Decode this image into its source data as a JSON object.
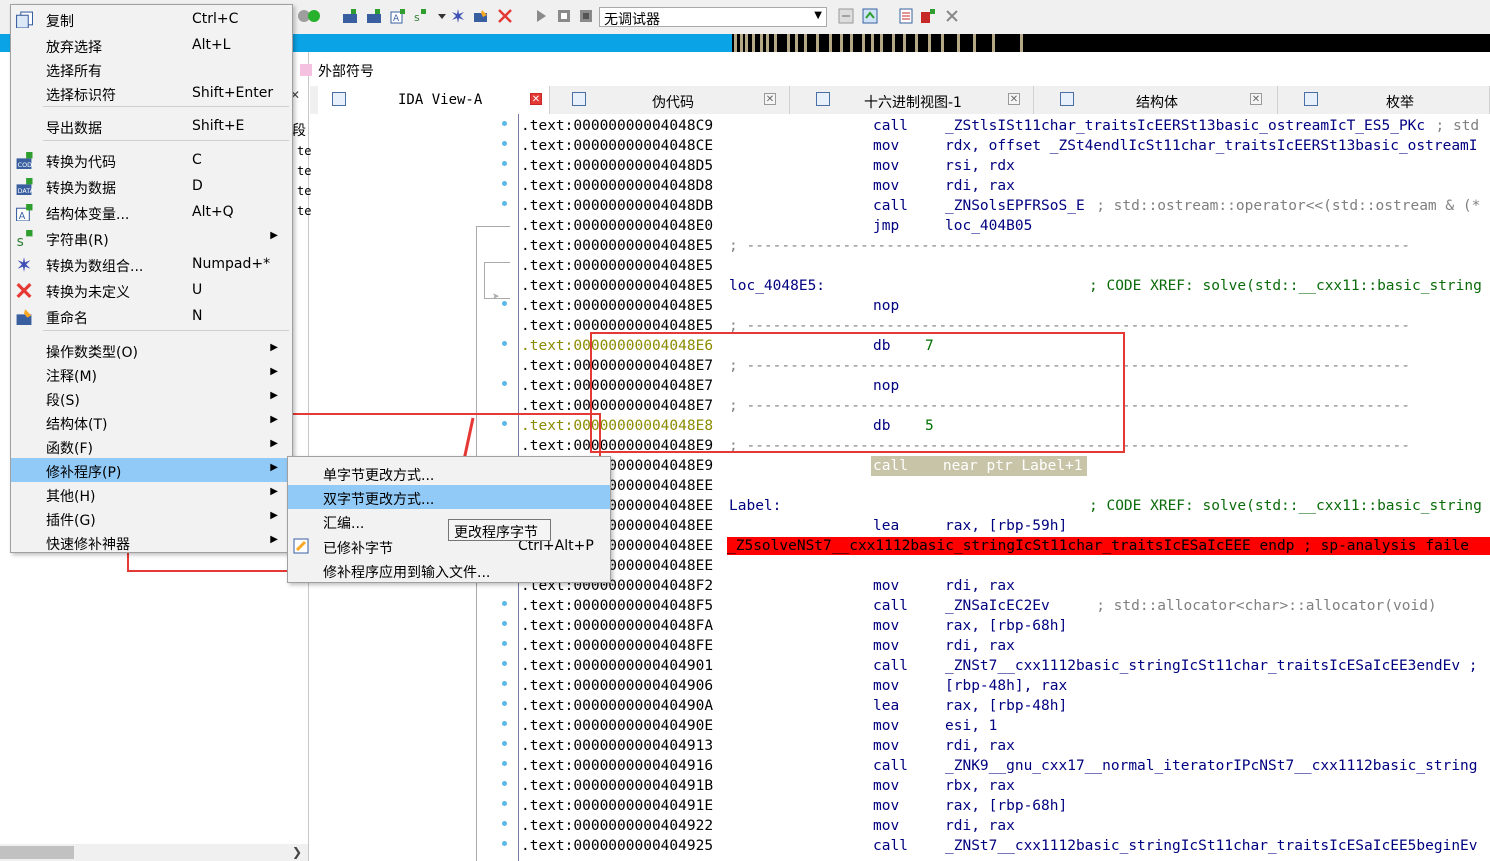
{
  "toolbar": {
    "debugger_value": "无调试器"
  },
  "left_pane": {
    "ext_symbols_tab": "外部符号",
    "seg_label": "段",
    "row_te": [
      "te",
      "te",
      "te",
      "te"
    ]
  },
  "tabs": [
    {
      "label": "IDA View-A",
      "active": true
    },
    {
      "label": "伪代码",
      "active": false
    },
    {
      "label": "十六进制视图-1",
      "active": false
    },
    {
      "label": "结构体",
      "active": false
    },
    {
      "label": "枚举",
      "active": false
    }
  ],
  "context_menu": {
    "items": [
      {
        "label": "复制",
        "key": "Ctrl+C",
        "icon": "copy-icon"
      },
      {
        "label": "放弃选择",
        "key": "Alt+L"
      },
      {
        "label": "选择所有",
        "key": ""
      },
      {
        "label": "选择标识符",
        "key": "Shift+Enter"
      },
      {
        "label": "导出数据",
        "key": "Shift+E"
      },
      {
        "label": "转换为代码",
        "key": "C",
        "icon": "code-icon"
      },
      {
        "label": "转换为数据",
        "key": "D",
        "icon": "data-icon"
      },
      {
        "label": "结构体变量...",
        "key": "Alt+Q",
        "icon": "struct-var-icon"
      },
      {
        "label": "字符串(R)",
        "key": "",
        "icon": "string-icon"
      },
      {
        "label": "转换为数组合...",
        "key": "Numpad+*",
        "icon": "array-icon"
      },
      {
        "label": "转换为未定义",
        "key": "U",
        "icon": "undefine-icon"
      },
      {
        "label": "重命名",
        "key": "N",
        "icon": "rename-icon"
      },
      {
        "label": "操作数类型(O)",
        "key": ""
      },
      {
        "label": "注释(M)",
        "key": ""
      },
      {
        "label": "段(S)",
        "key": ""
      },
      {
        "label": "结构体(T)",
        "key": ""
      },
      {
        "label": "函数(F)",
        "key": ""
      },
      {
        "label": "修补程序(P)",
        "key": ""
      },
      {
        "label": "其他(H)",
        "key": ""
      },
      {
        "label": "插件(G)",
        "key": ""
      },
      {
        "label": "快速修补神器",
        "key": ""
      }
    ]
  },
  "submenu": {
    "items": [
      {
        "label": "单字节更改方式...",
        "key": ""
      },
      {
        "label": "双字节更改方式...",
        "key": ""
      },
      {
        "label": "汇编...",
        "key": ""
      },
      {
        "label": "已修补字节",
        "key": "Ctrl+Alt+P"
      },
      {
        "label": "修补程序应用到输入文件...",
        "key": ""
      }
    ]
  },
  "tooltip": "更改程序字节",
  "disasm": {
    "lines": [
      {
        "addr": ".text:00000000004048C9",
        "mnem": "call",
        "ops": "_ZStlsISt11char_traitsIcEERSt13basic_ostreamIcT_ES5_PKc",
        "cmt": "; std"
      },
      {
        "addr": ".text:00000000004048CE",
        "mnem": "mov",
        "ops": "rdx, offset _ZSt4endlIcSt11char_traitsIcEERSt13basic_ostreamI",
        "cmt": ""
      },
      {
        "addr": ".text:00000000004048D5",
        "mnem": "mov",
        "ops": "rsi, rdx",
        "cmt": ""
      },
      {
        "addr": ".text:00000000004048D8",
        "mnem": "mov",
        "ops": "rdi, rax",
        "cmt": ""
      },
      {
        "addr": ".text:00000000004048DB",
        "mnem": "call",
        "ops": "_ZNSolsEPFRSoS_E",
        "cmt": "; std::ostream::operator<<(std::ostream & (*"
      },
      {
        "addr": ".text:00000000004048E0",
        "mnem": "jmp",
        "ops": "loc_404B05",
        "cmt": ""
      },
      {
        "addr": ".text:00000000004048E5",
        "sep": "; ----------------------------------------------------------------------------"
      },
      {
        "addr": ".text:00000000004048E5"
      },
      {
        "addr": ".text:00000000004048E5",
        "label": "loc_4048E5:",
        "xref": "; CODE XREF: solve(std::__cxx11::basic_string"
      },
      {
        "addr": ".text:00000000004048E5",
        "mnem": "nop",
        "ops": "",
        "cmt": ""
      },
      {
        "addr": ".text:00000000004048E5",
        "sep": "; ----------------------------------------------------------------------------"
      },
      {
        "addr": ".text:00000000004048E6",
        "olive": true,
        "mnem": "db",
        "ops": "7",
        "num": true
      },
      {
        "addr": ".text:00000000004048E7",
        "sep": "; ----------------------------------------------------------------------------"
      },
      {
        "addr": ".text:00000000004048E7",
        "mnem": "nop",
        "ops": ""
      },
      {
        "addr": ".text:00000000004048E7",
        "sep": "; ----------------------------------------------------------------------------"
      },
      {
        "addr": ".text:00000000004048E8",
        "olive": true,
        "mnem": "db",
        "ops": "5",
        "num": true
      },
      {
        "addr": ".text:00000000004048E9",
        "sep": "; ----------------------------------------------------------------------------"
      },
      {
        "addr": ".text:00000000004048E9",
        "hlcall": "call    near ptr Label+1"
      },
      {
        "addr": ".text:00000000004048EE"
      },
      {
        "addr": ".text:00000000004048EE",
        "label": "Label:",
        "xref": "; CODE XREF: solve(std::__cxx11::basic_string"
      },
      {
        "addr": ".text:00000000004048EE",
        "mnem": "lea",
        "ops": "rax, [rbp-59h]"
      },
      {
        "addr": ".text:00000000004048EE",
        "endp": "_Z5solveNSt7__cxx1112basic_stringIcSt11char_traitsIcESaIcEEE endp ; sp-analysis faile"
      },
      {
        "addr": ".text:00000000004048EE"
      },
      {
        "addr": ".text:00000000004048F2",
        "mnem": "mov",
        "ops": "rdi, rax"
      },
      {
        "addr": ".text:00000000004048F5",
        "mnem": "call",
        "ops": "_ZNSaIcEC2Ev",
        "cmt": "; std::allocator<char>::allocator(void)"
      },
      {
        "addr": ".text:00000000004048FA",
        "mnem": "mov",
        "ops": "rax, [rbp-68h]"
      },
      {
        "addr": ".text:00000000004048FE",
        "mnem": "mov",
        "ops": "rdi, rax"
      },
      {
        "addr": ".text:0000000000404901",
        "mnem": "call",
        "ops": "_ZNSt7__cxx1112basic_stringIcSt11char_traitsIcESaIcEE3endEv ;"
      },
      {
        "addr": ".text:0000000000404906",
        "mnem": "mov",
        "ops": "[rbp-48h], rax"
      },
      {
        "addr": ".text:000000000040490A",
        "mnem": "lea",
        "ops": "rax, [rbp-48h]"
      },
      {
        "addr": ".text:000000000040490E",
        "mnem": "mov",
        "ops": "esi, 1"
      },
      {
        "addr": ".text:0000000000404913",
        "mnem": "mov",
        "ops": "rdi, rax"
      },
      {
        "addr": ".text:0000000000404916",
        "mnem": "call",
        "ops": "_ZNK9__gnu_cxx17__normal_iteratorIPcNSt7__cxx1112basic_string"
      },
      {
        "addr": ".text:000000000040491B",
        "mnem": "mov",
        "ops": "rbx, rax"
      },
      {
        "addr": ".text:000000000040491E",
        "mnem": "mov",
        "ops": "rax, [rbp-68h]"
      },
      {
        "addr": ".text:0000000000404922",
        "mnem": "mov",
        "ops": "rdi, rax"
      },
      {
        "addr": ".text:0000000000404925",
        "mnem": "call",
        "ops": "_ZNSt7__cxx1112basic_stringIcSt11char_traitsIcESaIcEE5beginEv"
      }
    ]
  },
  "colors": {
    "accent": "#0aa4e6",
    "menu_highlight": "#91c9f7",
    "annotation_red": "#e53935",
    "endp_red": "#ff0000"
  }
}
